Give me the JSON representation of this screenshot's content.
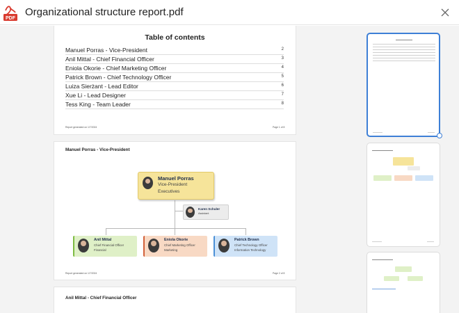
{
  "window": {
    "title": "Organizational structure report.pdf",
    "file_icon_text": "PDF"
  },
  "toc": {
    "title": "Table of contents",
    "entries": [
      {
        "label": "Manuel Porras - Vice-President",
        "page": "2"
      },
      {
        "label": "Anil Mittal - Chief Financial Officer",
        "page": "3"
      },
      {
        "label": "Eniola Okorie - Chief Marketing Officer",
        "page": "4"
      },
      {
        "label": "Patrick Brown - Chief Technology Officer",
        "page": "5"
      },
      {
        "label": "Luiza Sierżant - Lead Editor",
        "page": "6"
      },
      {
        "label": "Xue Li - Lead Designer",
        "page": "7"
      },
      {
        "label": "Tess King - Team Leader",
        "page": "8"
      }
    ]
  },
  "pages": {
    "p1": {
      "footer_left": "Report generated on 1/7/2024",
      "footer_right": "Page 1 of 8"
    },
    "p2": {
      "heading": "Manuel Porras - Vice-President",
      "footer_left": "Report generated on 1/7/2024",
      "footer_right": "Page 2 of 8",
      "nodes": {
        "manuel": {
          "name": "Manuel Porras",
          "title": "Vice-President",
          "dept": "Executives",
          "fill": "#f6e49a",
          "edge": "#e2c96a"
        },
        "karen": {
          "name": "Karen Schuler",
          "title": "Assistant",
          "fill": "#ececec",
          "edge": "#cfcfcf"
        },
        "anil": {
          "name": "Anil Mittal",
          "title": "Chief Financial Officer",
          "dept": "Financial",
          "fill": "#dff0c7",
          "edge": "#7dbb42"
        },
        "eniola": {
          "name": "Eniola Okorie",
          "title": "Chief Marketing Officer",
          "dept": "Marketing",
          "fill": "#f8d9c4",
          "edge": "#d2603a"
        },
        "patrick": {
          "name": "Patrick Brown",
          "title": "Chief Technology Officer",
          "dept": "Information Technology",
          "fill": "#cfe3f7",
          "edge": "#4a8fd6"
        }
      }
    },
    "p3": {
      "heading": "Anil Mittal - Chief Financial Officer"
    }
  },
  "thumbnails": [
    {
      "label": "Page 1",
      "selected": true
    },
    {
      "label": "Page 2",
      "selected": false
    },
    {
      "label": "Page 3",
      "selected": false
    }
  ]
}
